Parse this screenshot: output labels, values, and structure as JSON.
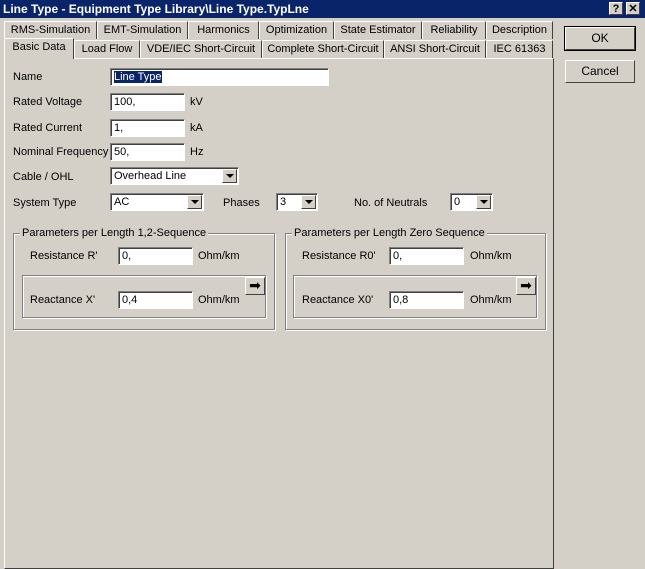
{
  "window": {
    "title": "Line Type - Equipment Type Library\\Line Type.TypLne",
    "help_label": "?",
    "close_label": "✕"
  },
  "tabs_row1": [
    "RMS-Simulation",
    "EMT-Simulation",
    "Harmonics",
    "Optimization",
    "State Estimator",
    "Reliability",
    "Description"
  ],
  "tabs_row2": [
    "Basic Data",
    "Load Flow",
    "VDE/IEC Short-Circuit",
    "Complete Short-Circuit",
    "ANSI Short-Circuit",
    "IEC 61363"
  ],
  "form": {
    "name_label": "Name",
    "name_value": "Line Type",
    "rated_voltage_label": "Rated Voltage",
    "rated_voltage_value": "100,",
    "rated_voltage_unit": "kV",
    "rated_current_label": "Rated Current",
    "rated_current_value": "1,",
    "rated_current_unit": "kA",
    "nominal_frequency_label": "Nominal Frequency",
    "nominal_frequency_value": "50,",
    "nominal_frequency_unit": "Hz",
    "cable_ohl_label": "Cable / OHL",
    "cable_ohl_value": "Overhead Line",
    "system_type_label": "System Type",
    "system_type_value": "AC",
    "phases_label": "Phases",
    "phases_value": "3",
    "neutrals_label": "No. of Neutrals",
    "neutrals_value": "0"
  },
  "positive_seq": {
    "title": "Parameters per Length 1,2-Sequence",
    "resistance_label": "Resistance R'",
    "resistance_value": "0,",
    "resistance_unit": "Ohm/km",
    "reactance_label": "Reactance X'",
    "reactance_value": "0,4",
    "reactance_unit": "Ohm/km"
  },
  "zero_seq": {
    "title": "Parameters per Length Zero Sequence",
    "resistance_label": "Resistance R0'",
    "resistance_value": "0,",
    "resistance_unit": "Ohm/km",
    "reactance_label": "Reactance X0'",
    "reactance_value": "0,8",
    "reactance_unit": "Ohm/km"
  },
  "buttons": {
    "ok": "OK",
    "cancel": "Cancel",
    "arrow": "➡"
  }
}
